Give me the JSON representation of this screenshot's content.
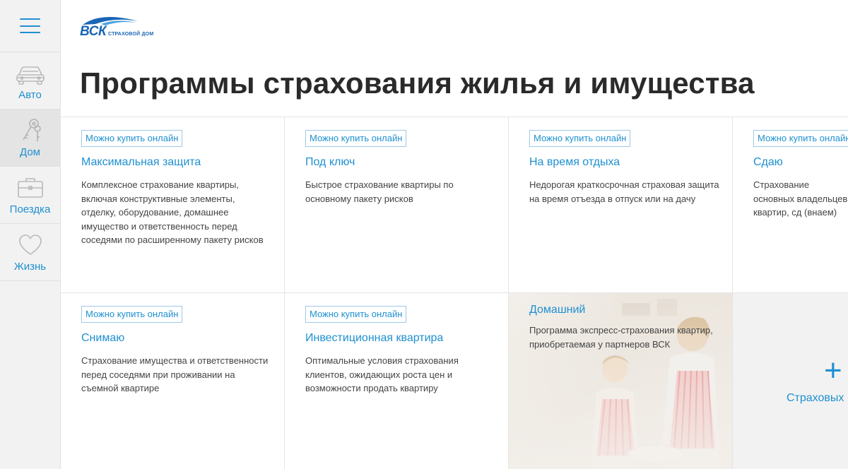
{
  "brand": {
    "logo_text": "ВСК",
    "logo_subtitle": "СТРАХОВОЙ ДОМ",
    "accent_color": "#1f90d0"
  },
  "sidebar": {
    "menu_icon": "hamburger-icon",
    "items": [
      {
        "label": "Авто",
        "icon": "car-icon",
        "active": false
      },
      {
        "label": "Дом",
        "icon": "keys-icon",
        "active": true
      },
      {
        "label": "Поездка",
        "icon": "suitcase-icon",
        "active": false
      },
      {
        "label": "Жизнь",
        "icon": "heart-icon",
        "active": false
      }
    ]
  },
  "page": {
    "title": "Программы страхования жилья и имущества"
  },
  "cards": [
    {
      "badge": "Можно купить онлайн",
      "title": "Максимальная защита",
      "description": "Комплексное страхование квартиры, включая конструктивные элементы, отделку, оборудование, домашнее имущество и ответственность перед соседями по расширенному пакету рисков"
    },
    {
      "badge": "Можно купить онлайн",
      "title": "Под ключ",
      "description": "Быстрое страхование квартиры по основному пакету рисков"
    },
    {
      "badge": "Можно купить онлайн",
      "title": "На время отдыха",
      "description": "Недорогая краткосрочная страховая защита на время отъезда в отпуск или на дачу"
    },
    {
      "badge": "Можно купить онлайн",
      "title": "Сдаю",
      "description": "Страхование основных владельцев квартир, сд (внаем)"
    },
    {
      "badge": "Можно купить онлайн",
      "title": "Снимаю",
      "description": "Страхование имущества и ответственности перед соседями при проживании на съемной квартире"
    },
    {
      "badge": "Можно купить онлайн",
      "title": "Инвестиционная квартира",
      "description": "Оптимальные условия страхования клиентов, ожидающих роста цен и возможности продать квартиру"
    },
    {
      "title": "Домашний",
      "description": "Программа экспресс-страхования квартир, приобретаемая у партнеров ВСК"
    }
  ],
  "more_card": {
    "plus": "+",
    "label": "Страховых"
  }
}
